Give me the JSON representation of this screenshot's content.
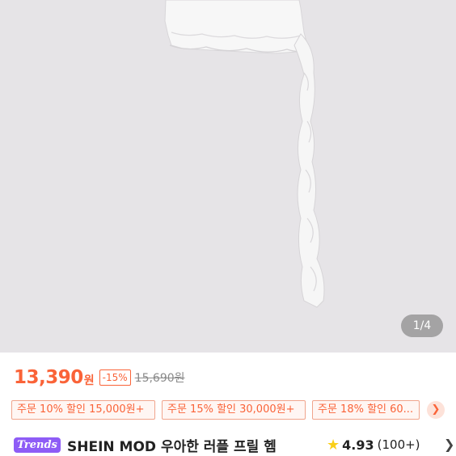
{
  "gallery": {
    "counter": "1/4"
  },
  "price": {
    "current": "13,390",
    "unit": "원",
    "discount": "-15%",
    "original": "15,690원"
  },
  "coupons": [
    {
      "label": "주문 10% 할인 15,000원+"
    },
    {
      "label": "주문 15% 할인 30,000원+"
    },
    {
      "label": "주문 18% 할인 60..."
    }
  ],
  "product": {
    "badge": "Trends",
    "title": "SHEIN MOD 우아한 러플 프릴 헴",
    "rating": "4.93",
    "review_count": "(100+)"
  },
  "icons": {
    "star": "star-icon",
    "chevron": "chevron-right-icon",
    "coupon_more": "chevron-right-icon"
  },
  "colors": {
    "accent": "#fa6338",
    "trends": "#8e5cf6",
    "star": "#facf19",
    "hero_bg": "#e6e4e7"
  }
}
